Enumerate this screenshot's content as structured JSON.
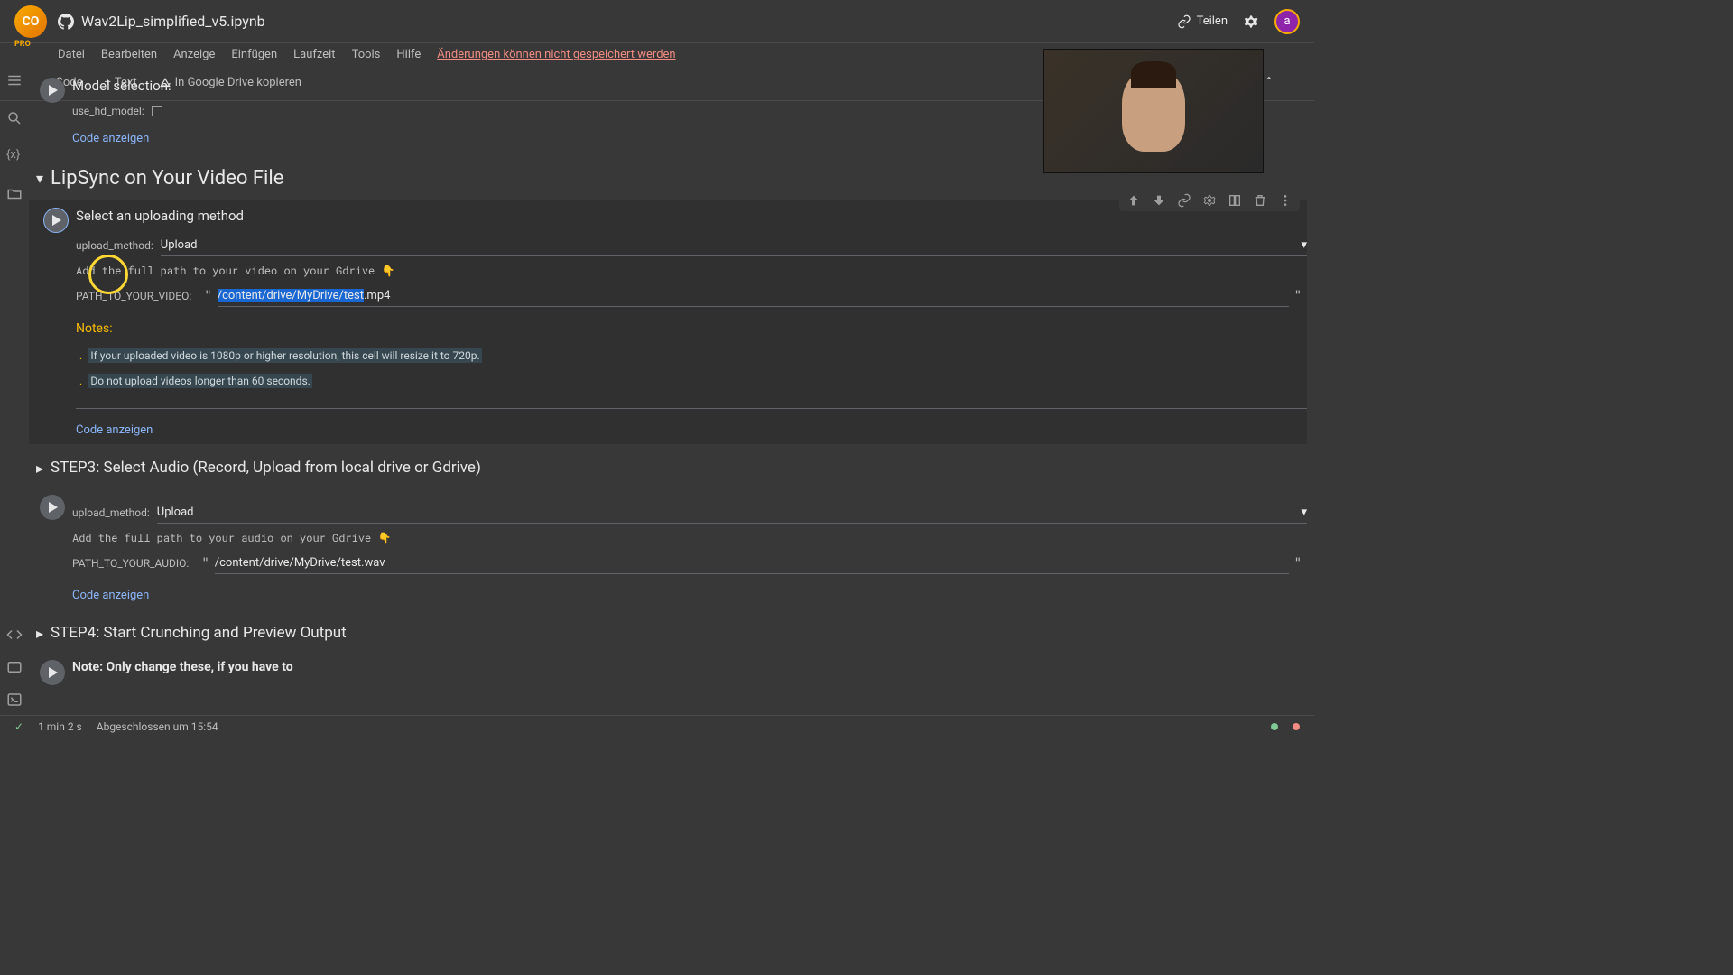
{
  "header": {
    "title": "Wav2Lip_simplified_v5.ipynb",
    "share": "Teilen",
    "avatar": "a"
  },
  "menu": {
    "items": [
      "Datei",
      "Bearbeiten",
      "Anzeige",
      "Einfügen",
      "Laufzeit",
      "Tools",
      "Hilfe"
    ],
    "warning": "Änderungen können nicht gespeichert werden"
  },
  "toolbar": {
    "code": "Code",
    "text": "Text",
    "copy": "In Google Drive kopieren"
  },
  "cell_model": {
    "title": "Model selection:",
    "label": "use_hd_model:",
    "show_code": "Code anzeigen"
  },
  "section_lipsync": {
    "title": "LipSync on Your Video File"
  },
  "cell_upload_video": {
    "title": "Select an uploading method",
    "upload_method_label": "upload_method:",
    "upload_method_value": "Upload",
    "path_note": "Add the full path to your video on your Gdrive 👇",
    "path_label": "PATH_TO_YOUR_VIDEO:",
    "path_value_prefix": "/content/drive/MyDrive/test",
    "path_value_suffix": ".mp4",
    "notes_header": "Notes:",
    "note1": "If your uploaded video is 1080p or higher resolution, this cell will resize it to 720p.",
    "note2": "Do not upload videos longer than 60 seconds.",
    "show_code": "Code anzeigen"
  },
  "section_step3": {
    "title": "STEP3: Select Audio (Record, Upload from local drive or Gdrive)"
  },
  "cell_upload_audio": {
    "upload_method_label": "upload_method:",
    "upload_method_value": "Upload",
    "path_note": "Add the full path to your audio on your Gdrive 👇",
    "path_label": "PATH_TO_YOUR_AUDIO:",
    "path_value": "/content/drive/MyDrive/test.wav",
    "show_code": "Code anzeigen"
  },
  "section_step4": {
    "title": "STEP4: Start Crunching and Preview Output"
  },
  "cell_step4": {
    "note": "Note: Only change these, if you have to"
  },
  "status": {
    "duration": "1 min 2 s",
    "completed": "Abgeschlossen um 15:54"
  }
}
